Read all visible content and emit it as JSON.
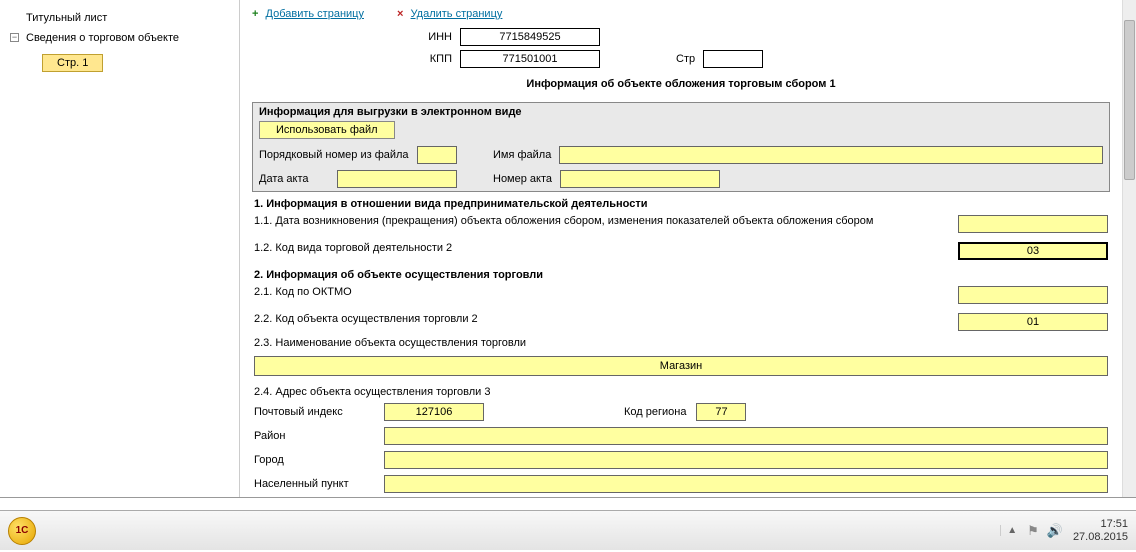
{
  "sidebar": {
    "items": [
      {
        "label": "Титульный лист"
      },
      {
        "label": "Сведения о торговом объекте"
      }
    ],
    "page_label": "Стр. 1"
  },
  "actions": {
    "add_page": "Добавить страницу",
    "delete_page": "Удалить страницу"
  },
  "header": {
    "inn_label": "ИНН",
    "inn_value": "7715849525",
    "kpp_label": "КПП",
    "kpp_value": "771501001",
    "str_label": "Стр",
    "str_value": ""
  },
  "title": "Информация об объекте обложения торговым сбором 1",
  "export_block": {
    "header": "Информация для выгрузки в электронном виде",
    "use_file_btn": "Использовать файл",
    "seq_label": "Порядковый номер из файла",
    "filename_label": "Имя файла",
    "act_date_label": "Дата акта",
    "act_num_label": "Номер акта"
  },
  "section1": {
    "header": "1. Информация в отношении вида предпринимательской деятельности",
    "row11": "1.1. Дата возникновения (прекращения) объекта обложения сбором, изменения показателей объекта обложения сбором",
    "row12": "1.2. Код вида торговой деятельности 2",
    "val12": "03"
  },
  "section2": {
    "header": "2. Информация об объекте осуществления торговли",
    "row21": "2.1. Код по ОКТМО",
    "row22": "2.2. Код объекта осуществления торговли 2",
    "val22": "01",
    "row23": "2.3. Наименование объекта осуществления торговли",
    "val23": "Магазин",
    "row24": "2.4. Адрес объекта осуществления торговли 3"
  },
  "address": {
    "postal_label": "Почтовый индекс",
    "postal_value": "127106",
    "region_label": "Код региона",
    "region_value": "77",
    "district_label": "Район",
    "city_label": "Город",
    "locality_label": "Населенный пункт"
  },
  "taskbar": {
    "logo": "1С",
    "time": "17:51",
    "date": "27.08.2015"
  }
}
